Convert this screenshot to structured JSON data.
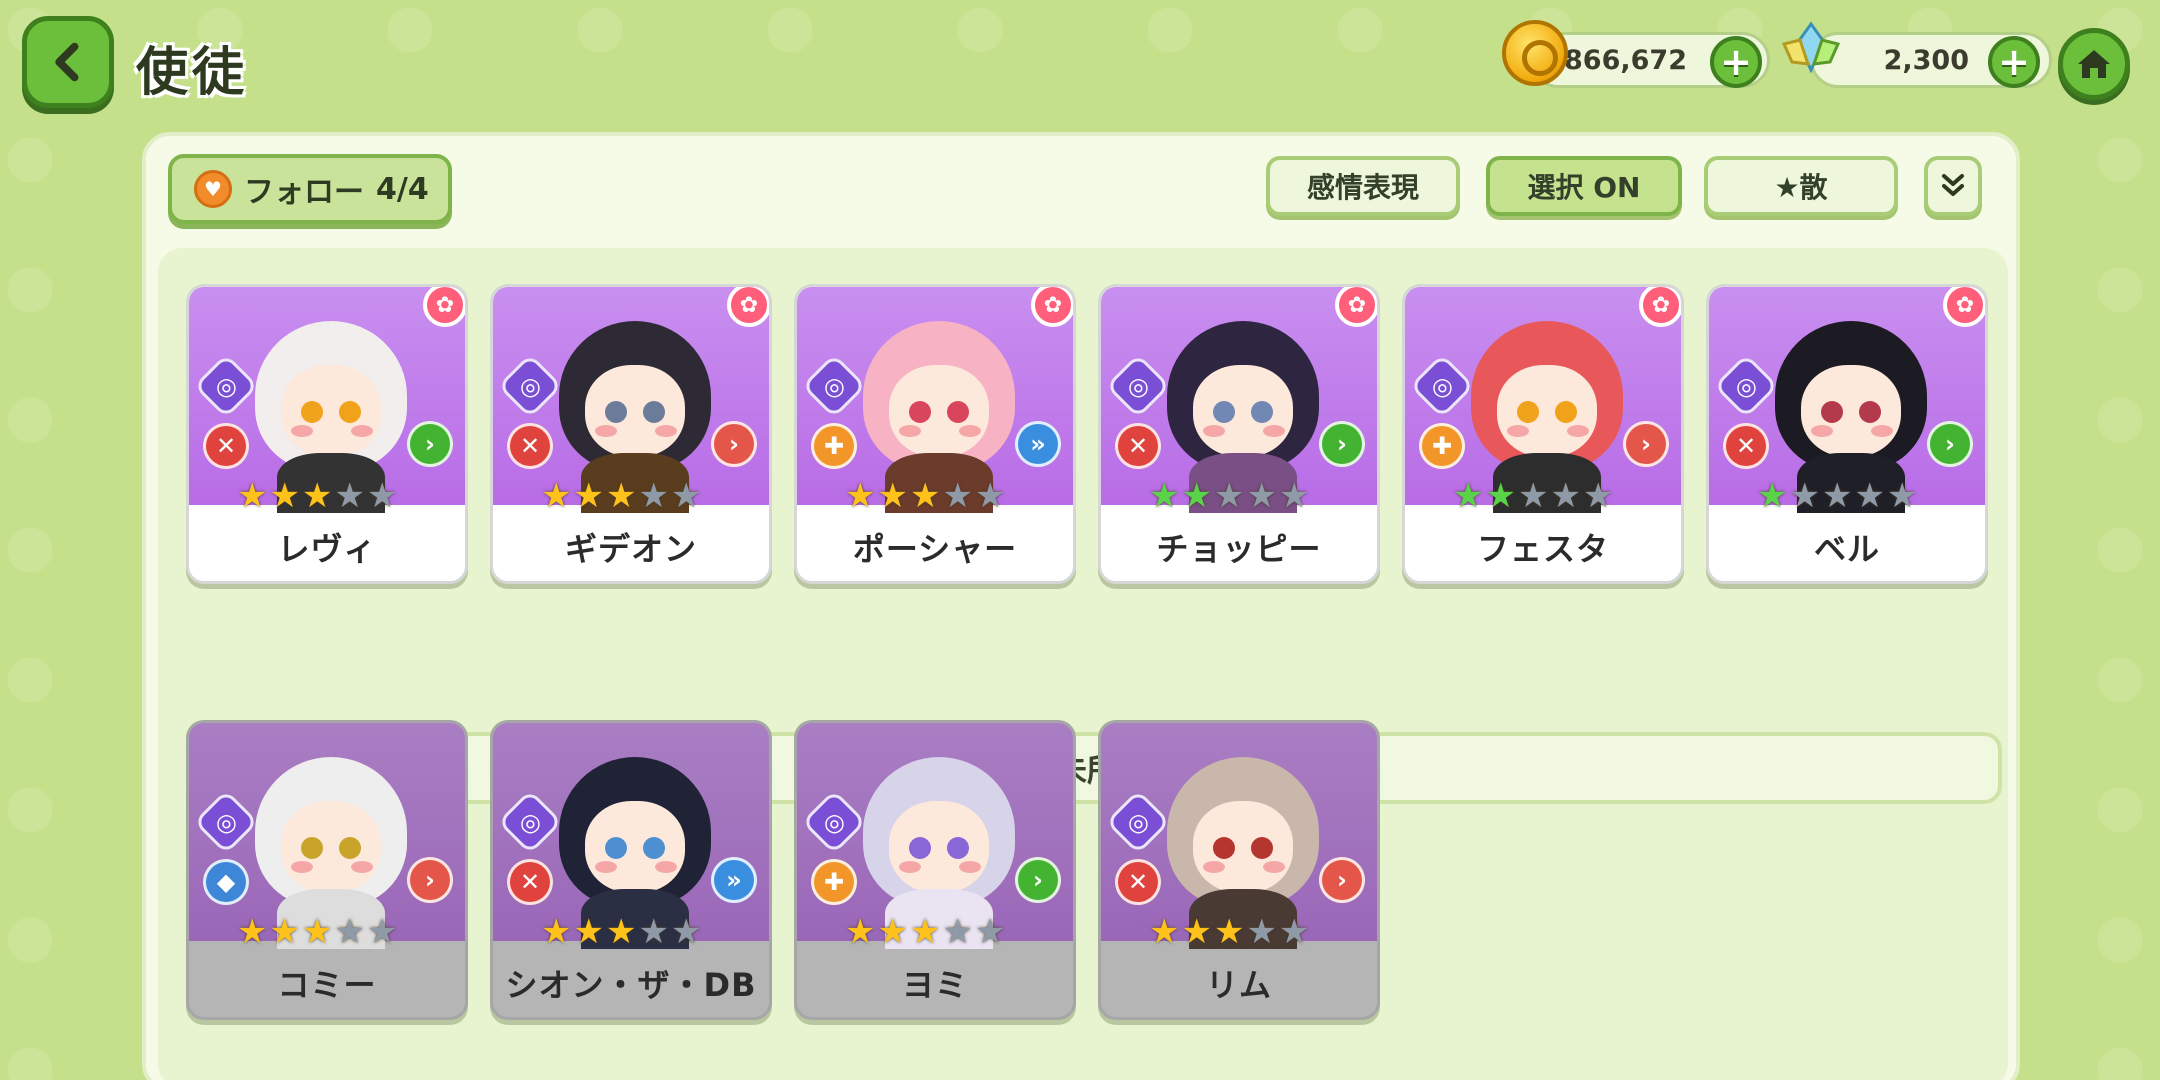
{
  "header": {
    "title": "使徒",
    "gold_amount": "866,672",
    "gem_amount": "2,300"
  },
  "toolbar": {
    "follow_label": "フォロー",
    "follow_count": "4/4",
    "emotion_label": "感情表現",
    "select_label": "選択 ON",
    "sort_label": "★散"
  },
  "owned_section": {
    "cards": [
      {
        "name": "レヴィ",
        "stars_filled": 3,
        "star_color": "gold",
        "role": "red",
        "cls": "green",
        "hair": "#f2eeee",
        "eye": "#f0a21a",
        "outfit": "#333333"
      },
      {
        "name": "ギデオン",
        "stars_filled": 3,
        "star_color": "gold",
        "role": "red",
        "cls": "red",
        "hair": "#2d2a35",
        "eye": "#6b7b9a",
        "outfit": "#5a3d1f"
      },
      {
        "name": "ポーシャー",
        "stars_filled": 3,
        "star_color": "gold",
        "role": "orange",
        "cls": "blue",
        "hair": "#f7b2c4",
        "eye": "#d9455d",
        "outfit": "#6b3b2b"
      },
      {
        "name": "チョッピー",
        "stars_filled": 2,
        "star_color": "green",
        "role": "red",
        "cls": "green",
        "hair": "#2e2540",
        "eye": "#7088b3",
        "outfit": "#7a4f86"
      },
      {
        "name": "フェスタ",
        "stars_filled": 2,
        "star_color": "green",
        "role": "orange",
        "cls": "red",
        "hair": "#e8575a",
        "eye": "#f0a21a",
        "outfit": "#2d2d2d"
      },
      {
        "name": "ベル",
        "stars_filled": 1,
        "star_color": "green",
        "role": "red",
        "cls": "green",
        "hair": "#1c1a22",
        "eye": "#b33a4a",
        "outfit": "#1f1f28"
      }
    ]
  },
  "unowned_section": {
    "label": "未所持",
    "cards": [
      {
        "name": "コミー",
        "stars_filled": 3,
        "star_color": "gold",
        "role": "blue",
        "cls": "red",
        "hair": "#eeeeee",
        "eye": "#c9a42a",
        "outfit": "#dddddd"
      },
      {
        "name": "シオン・ザ・DB",
        "stars_filled": 3,
        "star_color": "gold",
        "role": "red",
        "cls": "blue",
        "hair": "#1f2335",
        "eye": "#4e8fd1",
        "outfit": "#2b2f44"
      },
      {
        "name": "ヨミ",
        "stars_filled": 3,
        "star_color": "gold",
        "role": "orange",
        "cls": "green",
        "hair": "#d7d3e8",
        "eye": "#8a67d6",
        "outfit": "#e9e3f2"
      },
      {
        "name": "リム",
        "stars_filled": 3,
        "star_color": "gold",
        "role": "red",
        "cls": "red",
        "hair": "#c9b7ac",
        "eye": "#b5362f",
        "outfit": "#4a3a34"
      }
    ]
  }
}
